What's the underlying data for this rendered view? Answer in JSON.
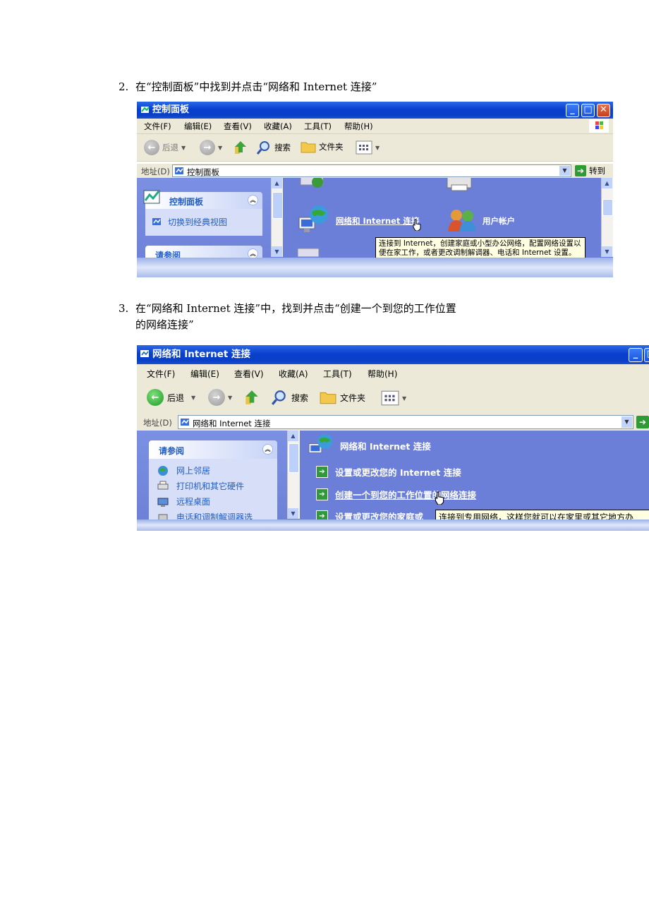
{
  "step2": {
    "number": "2.",
    "text": "在“控制面板”中找到并点击“网络和 Internet 连接”"
  },
  "step3": {
    "number": "3.",
    "line1": "在“网络和 Internet 连接”中，找到并点击“创建一个到您的工作位置",
    "line2": "的网络连接”"
  },
  "window1": {
    "title": "控制面板",
    "menu": [
      "文件(F)",
      "编辑(E)",
      "查看(V)",
      "收藏(A)",
      "工具(T)",
      "帮助(H)"
    ],
    "toolbar": {
      "back": "后退",
      "search": "搜索",
      "folders": "文件夹"
    },
    "address": {
      "label": "地址(D)",
      "value": "控制面板",
      "go": "转到"
    },
    "panel1": {
      "title": "控制面板",
      "link": "切换到经典视图"
    },
    "panel2": {
      "title": "请参阅"
    },
    "categories": {
      "network": "网络和 Internet 连接",
      "users": "用户帐户"
    },
    "tooltip": "连接到 Internet，创建家庭或小型办公网络，配置网络设置以便在家工作，或者更改调制解调器、电话和 Internet 设置。"
  },
  "window2": {
    "title": "网络和 Internet 连接",
    "menu": [
      "文件(F)",
      "编辑(E)",
      "查看(V)",
      "收藏(A)",
      "工具(T)",
      "帮助(H)"
    ],
    "toolbar": {
      "back": "后退",
      "search": "搜索",
      "folders": "文件夹"
    },
    "address": {
      "label": "地址(D)",
      "value": "网络和 Internet 连接"
    },
    "panel": {
      "title": "请参阅",
      "links": [
        "网上邻居",
        "打印机和其它硬件",
        "远程桌面",
        "电话和调制解调器选"
      ]
    },
    "heading": "网络和 Internet 连接",
    "tasks": [
      "设置或更改您的 Internet 连接",
      "创建一个到您的工作位置的网络连接",
      "设置或更改您的家庭或"
    ],
    "tooltip": "连接到专用网络，这样您就可以在家里或其它地方办"
  },
  "colors": {
    "titlebar": "#0a3fcf",
    "content": "#6b7fd9",
    "link": "#215dc6",
    "tooltip": "#ffffe1"
  }
}
